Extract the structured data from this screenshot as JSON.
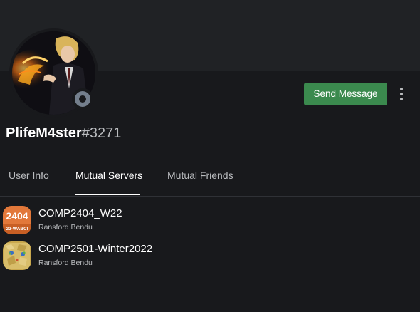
{
  "profile": {
    "username": "PlifeM4ster",
    "discriminator": "#3271",
    "status": "offline"
  },
  "actions": {
    "send_message": "Send Message",
    "more_icon": "more-vertical-icon"
  },
  "tabs": [
    {
      "label": "User Info",
      "active": false
    },
    {
      "label": "Mutual Servers",
      "active": true
    },
    {
      "label": "Mutual Friends",
      "active": false
    }
  ],
  "servers": [
    {
      "name": "COMP2404_W22",
      "subtitle": "Ransford Bendu",
      "icon_top": "2404",
      "icon_bottom": "22-WABCI"
    },
    {
      "name": "COMP2501-Winter2022",
      "subtitle": "Ransford Bendu"
    }
  ],
  "colors": {
    "background": "#18191c",
    "banner": "#202225",
    "send_button": "#3b8a4e",
    "status_offline": "#747f8d"
  }
}
